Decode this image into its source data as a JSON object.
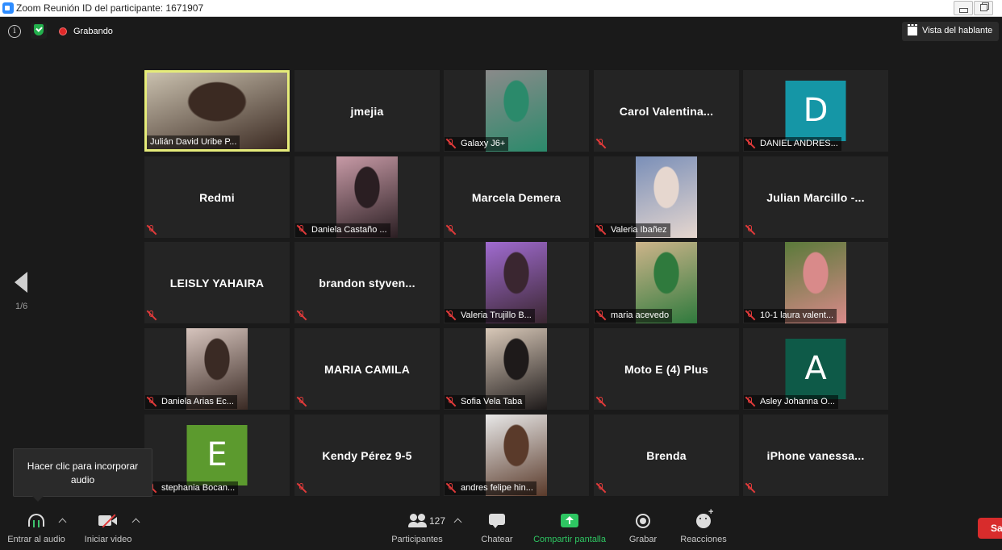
{
  "window": {
    "title": "Zoom Reunión ID del participante: 1671907"
  },
  "topbar": {
    "recording_label": "Grabando",
    "view_label": "Vista del hablante"
  },
  "pagination": {
    "label": "1/6"
  },
  "tooltip": {
    "line1": "Hacer clic para incorporar",
    "line2": "audio"
  },
  "tiles": [
    {
      "kind": "photo",
      "name": "Julián David Uribe P...",
      "active": true,
      "muted": false,
      "photo_colors": [
        "#c9c0ae",
        "#3b2a22"
      ]
    },
    {
      "kind": "name",
      "display": "jmejia",
      "muted": false
    },
    {
      "kind": "photo",
      "name": "Galaxy J6+",
      "muted": true,
      "photo_colors": [
        "#8a8a8a",
        "#2b8a6b"
      ]
    },
    {
      "kind": "name",
      "display": "Carol  Valentina...",
      "muted": true
    },
    {
      "kind": "avatar",
      "letter": "D",
      "name": "DANIEL ANDRES...",
      "muted": true,
      "color": "#1596a6"
    },
    {
      "kind": "name",
      "display": "Redmi",
      "muted": true
    },
    {
      "kind": "photo",
      "name": "Daniela Castaño ...",
      "muted": true,
      "photo_colors": [
        "#c79aa6",
        "#2a1e22"
      ]
    },
    {
      "kind": "name",
      "display": "Marcela Demera",
      "muted": true
    },
    {
      "kind": "photo",
      "name": "Valeria Ibañez",
      "muted": true,
      "photo_colors": [
        "#7a8fb8",
        "#e6d7cf"
      ]
    },
    {
      "kind": "name",
      "display": "Julian  Marcillo  -...",
      "muted": true
    },
    {
      "kind": "name",
      "display": "LEISLY YAHAIRA",
      "muted": true
    },
    {
      "kind": "name",
      "display": "brandon  styven...",
      "muted": true
    },
    {
      "kind": "photo",
      "name": "Valeria Trujillo B...",
      "muted": true,
      "photo_colors": [
        "#a06bd0",
        "#3a2630"
      ]
    },
    {
      "kind": "photo",
      "name": "maria acevedo",
      "muted": true,
      "photo_colors": [
        "#cdb48a",
        "#2f7a3d"
      ]
    },
    {
      "kind": "photo",
      "name": "10-1 laura valent...",
      "muted": true,
      "photo_colors": [
        "#5a7a3a",
        "#d98a8a"
      ]
    },
    {
      "kind": "photo",
      "name": "Daniela Arias Ec...",
      "muted": true,
      "photo_colors": [
        "#d6c4bd",
        "#3a2a24"
      ]
    },
    {
      "kind": "name",
      "display": "MARIA CAMILA",
      "muted": true
    },
    {
      "kind": "photo",
      "name": "Sofia Vela Taba",
      "muted": true,
      "photo_colors": [
        "#d8c8b8",
        "#1e1a1a"
      ]
    },
    {
      "kind": "name",
      "display": "Moto E (4) Plus",
      "muted": true
    },
    {
      "kind": "avatar",
      "letter": "A",
      "name": "Asley Johanna O...",
      "muted": true,
      "color": "#0e5a48"
    },
    {
      "kind": "avatar",
      "letter": "E",
      "name": "stephania Bocan...",
      "muted": true,
      "color": "#5c9a2e"
    },
    {
      "kind": "name",
      "display": "Kendy Pérez 9-5",
      "muted": true
    },
    {
      "kind": "photo",
      "name": "andres felipe hin...",
      "muted": true,
      "photo_colors": [
        "#e8e8e8",
        "#5a3a2a"
      ]
    },
    {
      "kind": "name",
      "display": "Brenda",
      "muted": true
    },
    {
      "kind": "name",
      "display": "iPhone  vanessa...",
      "muted": true
    }
  ],
  "bottombar": {
    "audio_label": "Entrar al audio",
    "video_label": "Iniciar video",
    "participants_label": "Participantes",
    "participants_count": "127",
    "chat_label": "Chatear",
    "share_label": "Compartir pantalla",
    "record_label": "Grabar",
    "reactions_label": "Reacciones",
    "leave_label": "Salir"
  },
  "colors": {
    "accent_green": "#2ec662",
    "active_border": "#e6ec7a",
    "record_red": "#e02828",
    "leave_red": "#d82c2c"
  }
}
